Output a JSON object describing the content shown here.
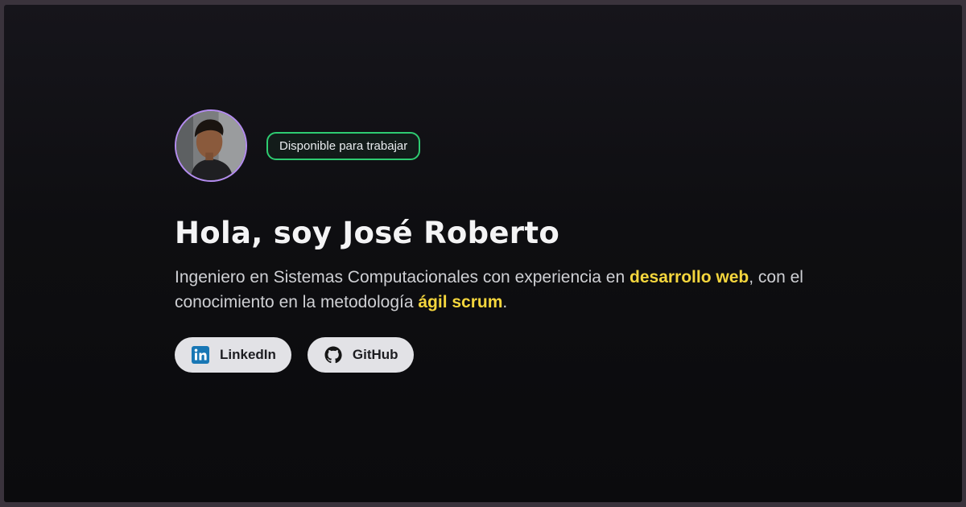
{
  "hero": {
    "badge": "Disponible para trabajar",
    "title": "Hola, soy José Roberto",
    "description": {
      "part1": "Ingeniero en Sistemas Computacionales con experiencia en ",
      "highlight1": "desarrollo web",
      "part2": ", con el conocimiento en la metodología ",
      "highlight2": "ágil scrum",
      "part3": "."
    },
    "buttons": [
      {
        "label": "LinkedIn",
        "icon": "linkedin-icon"
      },
      {
        "label": "GitHub",
        "icon": "github-icon"
      }
    ]
  },
  "colors": {
    "avatar_ring": "#b48cf0",
    "badge_border": "#2ecc71",
    "highlight": "#f5d63d",
    "button_bg": "#e2e2e6",
    "linkedin_blue": "#1877b5"
  }
}
